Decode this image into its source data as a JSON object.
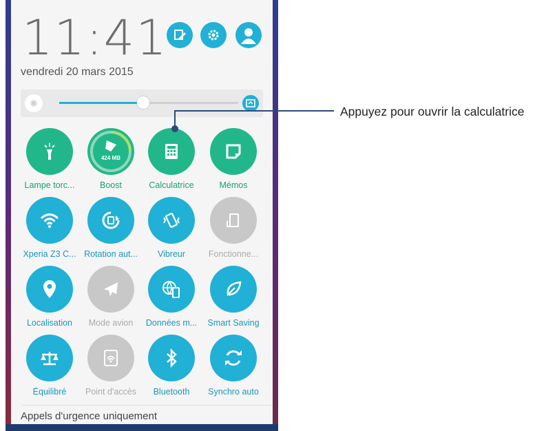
{
  "status": {
    "time": "11:41",
    "date": "vendredi 20 mars 2015"
  },
  "header_buttons": [
    {
      "icon": "edit-icon"
    },
    {
      "icon": "gear-icon"
    },
    {
      "icon": "user-icon"
    }
  ],
  "brightness": {
    "level_fraction": 0.47
  },
  "tiles": [
    {
      "label": "Lampe torc...",
      "icon": "flashlight-icon",
      "color": "#22b78b",
      "text_color": "#1a9e78"
    },
    {
      "label": "Boost",
      "icon": "boost-icon",
      "sublabel": "424 MB",
      "color": "#22b78b",
      "text_color": "#1a9e78"
    },
    {
      "label": "Calculatrice",
      "icon": "calculator-icon",
      "color": "#22b78b",
      "text_color": "#1a9e78"
    },
    {
      "label": "Mémos",
      "icon": "memo-icon",
      "color": "#22b78b",
      "text_color": "#1a9e78"
    },
    {
      "label": "Xperia Z3 C...",
      "icon": "wifi-icon",
      "color": "#21b0d6",
      "text_color": "#1a97bb"
    },
    {
      "label": "Rotation aut...",
      "icon": "rotation-icon",
      "color": "#21b0d6",
      "text_color": "#1a97bb"
    },
    {
      "label": "Vibreur",
      "icon": "vibrate-icon",
      "color": "#21b0d6",
      "text_color": "#1a97bb"
    },
    {
      "label": "Fonctionne...",
      "icon": "one-hand-icon",
      "color": "#c8c8c8",
      "text_color": "#aaaaaa"
    },
    {
      "label": "Localisation",
      "icon": "location-icon",
      "color": "#21b0d6",
      "text_color": "#1a97bb"
    },
    {
      "label": "Mode avion",
      "icon": "airplane-icon",
      "color": "#c8c8c8",
      "text_color": "#aaaaaa"
    },
    {
      "label": "Données m...",
      "icon": "mobile-data-icon",
      "color": "#21b0d6",
      "text_color": "#1a97bb"
    },
    {
      "label": "Smart Saving",
      "icon": "leaf-icon",
      "color": "#21b0d6",
      "text_color": "#1a97bb"
    },
    {
      "label": "Équilibré",
      "icon": "balance-icon",
      "color": "#21b0d6",
      "text_color": "#1a97bb"
    },
    {
      "label": "Point d'accès",
      "icon": "hotspot-icon",
      "color": "#c8c8c8",
      "text_color": "#aaaaaa"
    },
    {
      "label": "Bluetooth",
      "icon": "bluetooth-icon",
      "color": "#21b0d6",
      "text_color": "#1a97bb"
    },
    {
      "label": "Synchro auto",
      "icon": "sync-icon",
      "color": "#21b0d6",
      "text_color": "#1a97bb"
    }
  ],
  "footer": {
    "text": "Appels d'urgence uniquement"
  },
  "callout": {
    "text": "Appuyez pour ouvrir la calculatrice"
  }
}
